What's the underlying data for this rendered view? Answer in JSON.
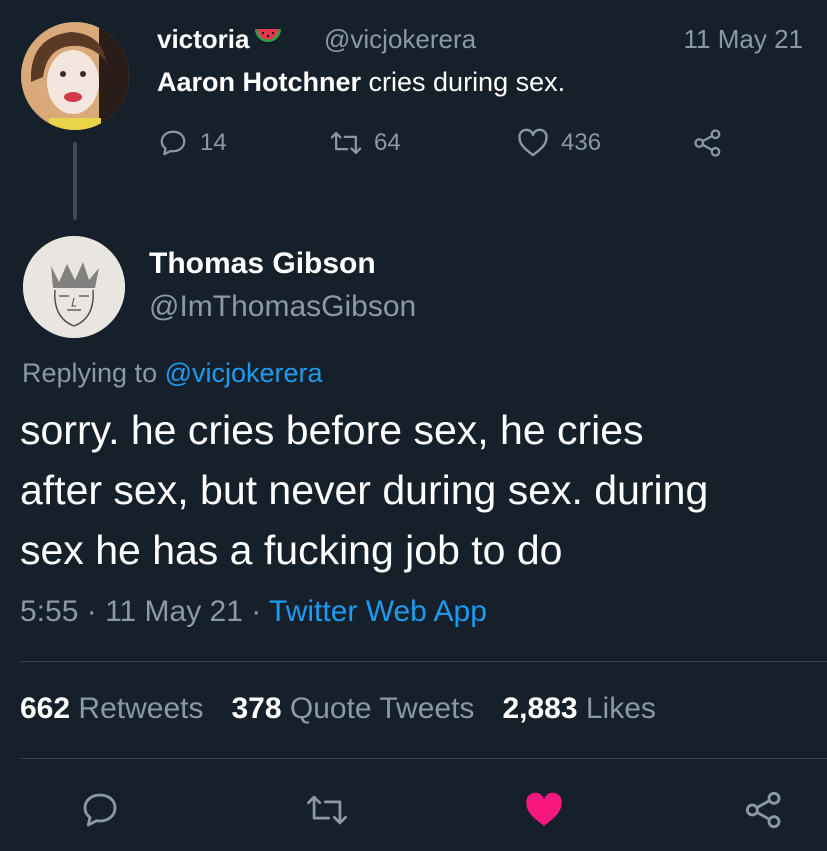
{
  "parent": {
    "display_name": "victoria",
    "name_emoji": "watermelon-emoji",
    "handle": "@vicjokerera",
    "date": "11 May 21",
    "text_bold": "Aaron Hotchner",
    "text_rest": " cries during sex.",
    "replies": "14",
    "retweets": "64",
    "likes": "436"
  },
  "reply": {
    "display_name": "Thomas Gibson",
    "handle": "@ImThomasGibson",
    "replying_prefix": "Replying to ",
    "replying_handle": "@vicjokerera",
    "text": "sorry. he cries before sex, he cries\nafter sex, but never during sex. during\nsex he has a fucking job to do",
    "time": "5:55",
    "sep1": " · ",
    "date": "11 May 21",
    "sep2": " · ",
    "source": "Twitter Web App",
    "retweets_count": "662",
    "retweets_label": "Retweets",
    "quotes_count": "378",
    "quotes_label": "Quote Tweets",
    "likes_count": "2,883",
    "likes_label": "Likes"
  },
  "colors": {
    "background": "#15202b",
    "muted": "#8b98a5",
    "link": "#1d9bf0",
    "like_active": "#f91880"
  }
}
